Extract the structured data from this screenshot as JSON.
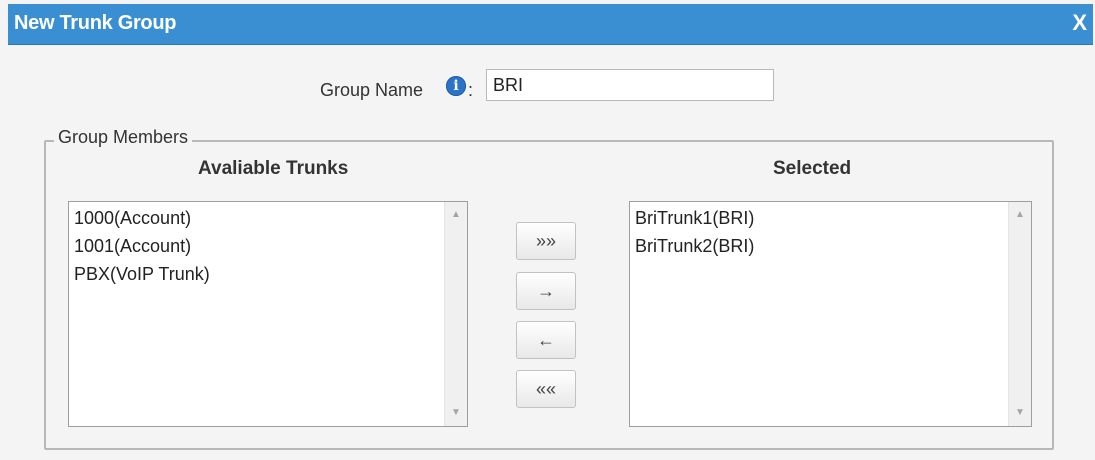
{
  "dialog": {
    "title": "New Trunk Group",
    "close_label": "X"
  },
  "group_name": {
    "label": "Group Name",
    "colon": ":",
    "info_icon": "i",
    "value": "BRI"
  },
  "group_members": {
    "legend": "Group Members",
    "available": {
      "header": "Avaliable Trunks",
      "items": [
        "1000(Account)",
        "1001(Account)",
        "PBX(VoIP Trunk)"
      ]
    },
    "selected": {
      "header": "Selected",
      "items": [
        "BriTrunk1(BRI)",
        "BriTrunk2(BRI)"
      ]
    },
    "buttons": {
      "move_all_right": "»»",
      "move_right": "→",
      "move_left": "←",
      "move_all_left": "««"
    }
  },
  "colors": {
    "title_bar": "#3a8fd2",
    "info_icon": "#2a73c7"
  }
}
